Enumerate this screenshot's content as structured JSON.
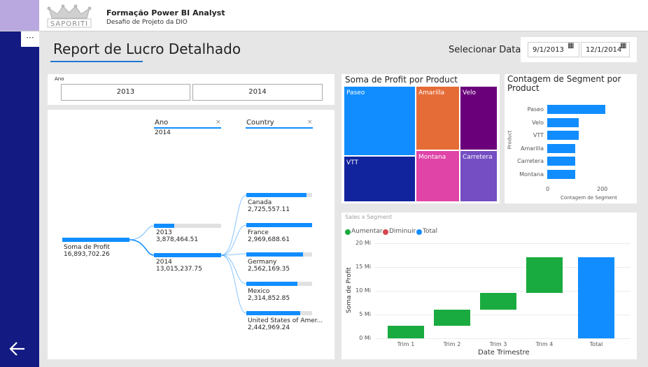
{
  "header": {
    "logo_text": "SAPORITI",
    "title": "Formação Power BI Analyst",
    "subtitle": "Desafio de Projeto da DIO"
  },
  "nav": {
    "more_label": "···",
    "back_icon": "arrow-left-icon"
  },
  "report": {
    "title": "Report de Lucro Detalhado",
    "date_label": "Selecionar Data",
    "date_start": "9/1/2013",
    "date_end": "12/1/2014"
  },
  "slicer": {
    "title": "Ano",
    "options": [
      "2013",
      "2014"
    ]
  },
  "decomp": {
    "col1_header": "Ano",
    "col1_selected": "2014",
    "col2_header": "Country",
    "root_label": "Soma de Profit",
    "root_value": "16,893,702.26",
    "years": [
      {
        "label": "2013",
        "value": "3,878,464.51",
        "fill": 0.3
      },
      {
        "label": "2014",
        "value": "13,015,237.75",
        "fill": 1.0
      }
    ],
    "countries": [
      {
        "label": "Canada",
        "value": "2,725,557.11",
        "fill": 0.92
      },
      {
        "label": "France",
        "value": "2,969,688.61",
        "fill": 1.0
      },
      {
        "label": "Germany",
        "value": "2,562,169.35",
        "fill": 0.86
      },
      {
        "label": "Mexico",
        "value": "2,314,852.85",
        "fill": 0.78
      },
      {
        "label": "United States of Amer...",
        "value": "2,442,969.24",
        "fill": 0.82
      }
    ]
  },
  "treemap": {
    "title": "Soma de Profit por Product",
    "tiles": [
      {
        "label": "Paseo",
        "color": "#118dff"
      },
      {
        "label": "Amarilla",
        "color": "#e66c37"
      },
      {
        "label": "Velo",
        "color": "#6b007b"
      },
      {
        "label": "VTT",
        "color": "#12239e"
      },
      {
        "label": "Montana",
        "color": "#e044a7"
      },
      {
        "label": "Carretera",
        "color": "#744ec2"
      }
    ]
  },
  "segment_chart": {
    "title": "Contagem de Segment por Product",
    "ylabel": "Product",
    "xlabel": "Contagem de Segment",
    "xticks": [
      "0",
      "200"
    ]
  },
  "chart_data": [
    {
      "type": "bar",
      "title": "Contagem de Segment por Product",
      "categories": [
        "Paseo",
        "Velo",
        "VTT",
        "Amarilla",
        "Carretera",
        "Montana"
      ],
      "values": [
        210,
        115,
        115,
        100,
        100,
        100
      ],
      "xlim": [
        0,
        240
      ],
      "xlabel": "Contagem de Segment",
      "ylabel": "Product"
    },
    {
      "type": "bar",
      "subtype": "waterfall",
      "title": "Sales x Segment",
      "categories": [
        "Trim 1",
        "Trim 2",
        "Trim 3",
        "Trim 4",
        "Total"
      ],
      "series": [
        {
          "name": "Aumentar",
          "color": "#1aab40",
          "start": [
            0,
            2.7,
            6.0,
            9.5,
            null
          ],
          "end": [
            2.7,
            6.0,
            9.5,
            17.0,
            null
          ]
        },
        {
          "name": "Diminuir",
          "color": "#d64550",
          "start": [
            null,
            null,
            null,
            null,
            null
          ],
          "end": [
            null,
            null,
            null,
            null,
            null
          ]
        },
        {
          "name": "Total",
          "color": "#118dff",
          "start": [
            null,
            null,
            null,
            null,
            0
          ],
          "end": [
            null,
            null,
            null,
            null,
            17.0
          ]
        }
      ],
      "ylim": [
        0,
        20
      ],
      "yticks": [
        "20 Mi",
        "15 Mi",
        "10 Mi",
        "5 Mi",
        "0 Mi"
      ],
      "xlabel": "Date Trimestre",
      "ylabel": "Soma de Profit"
    }
  ],
  "waterfall": {
    "title": "Sales x Segment",
    "legend": [
      "Aumentar",
      "Diminuir",
      "Total"
    ],
    "legend_colors": [
      "#1aab40",
      "#d64550",
      "#118dff"
    ],
    "xlabel": "Date Trimestre",
    "ylabel": "Soma de Profit"
  }
}
